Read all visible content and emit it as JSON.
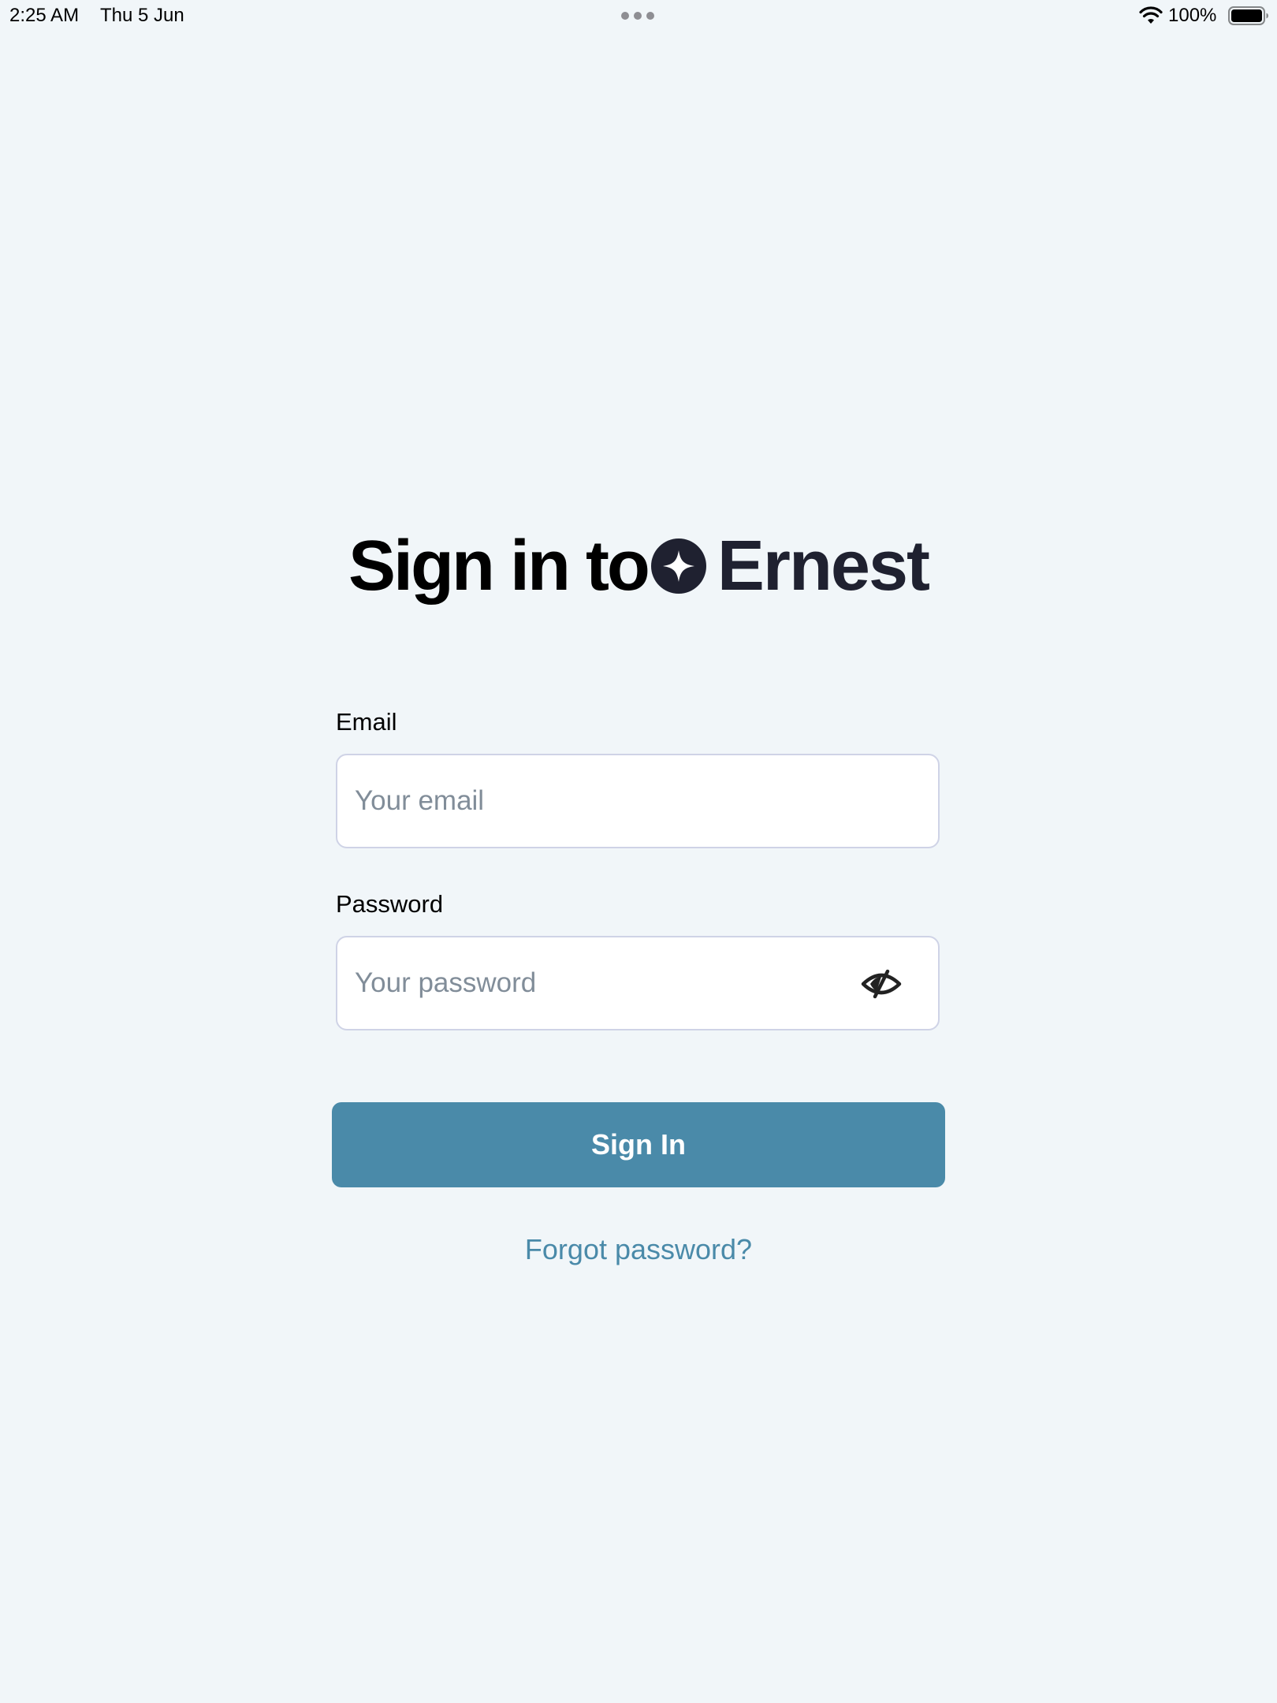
{
  "status_bar": {
    "time": "2:25 AM",
    "date": "Thu 5 Jun",
    "battery_percent": "100%",
    "battery_level": 1.0,
    "icons": [
      "more-dots-icon",
      "wifi-icon",
      "battery-icon"
    ]
  },
  "heading": {
    "prefix": "Sign in to",
    "brand_name": "Ernest",
    "brand_icon": "sparkle-logo-icon"
  },
  "form": {
    "email": {
      "label": "Email",
      "placeholder": "Your email",
      "value": ""
    },
    "password": {
      "label": "Password",
      "placeholder": "Your password",
      "value": "",
      "toggle_icon": "eye-slash-icon"
    },
    "submit_label": "Sign In",
    "forgot_label": "Forgot password?"
  },
  "colors": {
    "background": "#f1f6f9",
    "accent": "#4a8aa9",
    "brand_dark": "#1f2130",
    "input_border": "#cfd3e6",
    "placeholder": "#818d99"
  }
}
